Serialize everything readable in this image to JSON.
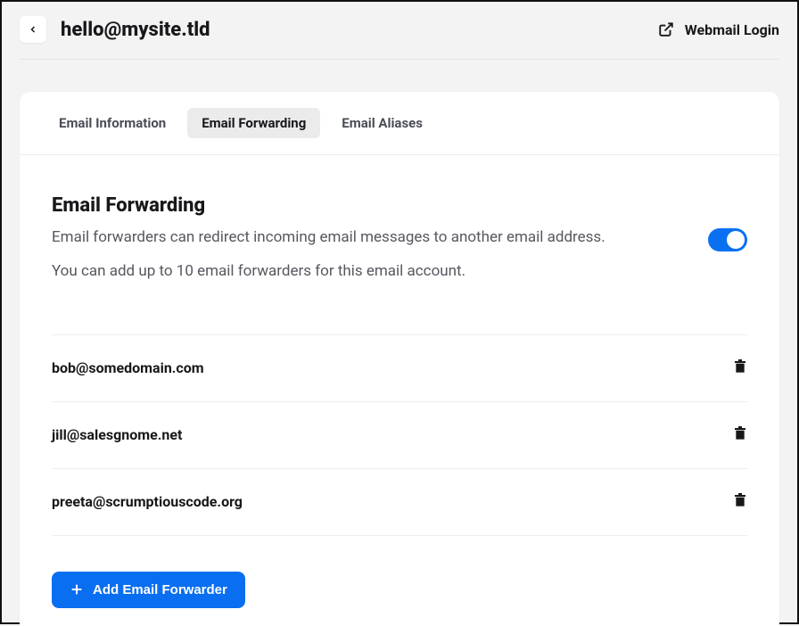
{
  "header": {
    "title": "hello@mysite.tld",
    "webmail_label": "Webmail Login"
  },
  "tabs": [
    {
      "label": "Email Information"
    },
    {
      "label": "Email Forwarding"
    },
    {
      "label": "Email Aliases"
    }
  ],
  "section": {
    "title": "Email Forwarding",
    "desc1": "Email forwarders can redirect incoming email messages to another email address.",
    "desc2": "You can add up to 10 email forwarders for this email account."
  },
  "forwarders": [
    {
      "email": "bob@somedomain.com"
    },
    {
      "email": "jill@salesgnome.net"
    },
    {
      "email": "preeta@scrumptiouscode.org"
    }
  ],
  "add_button_label": "Add Email Forwarder"
}
